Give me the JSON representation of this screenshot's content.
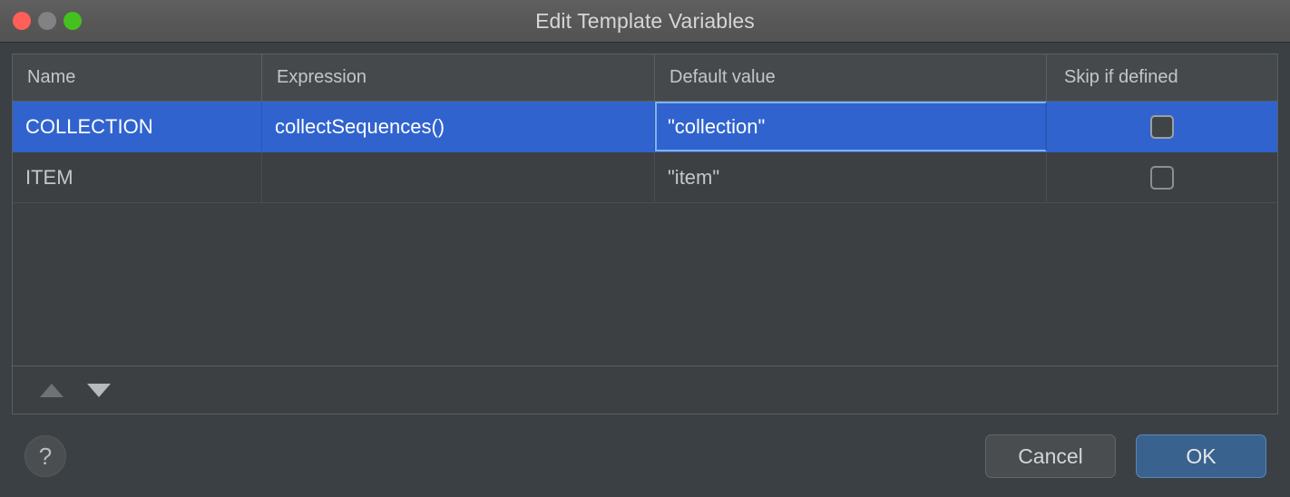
{
  "window": {
    "title": "Edit Template Variables",
    "traffic_lights": [
      {
        "name": "close",
        "color": "#ff5f57"
      },
      {
        "name": "minimize",
        "color": "#828282"
      },
      {
        "name": "zoom",
        "color": "#44c01f"
      }
    ]
  },
  "table": {
    "columns": [
      {
        "key": "name",
        "label": "Name"
      },
      {
        "key": "expression",
        "label": "Expression"
      },
      {
        "key": "default_value",
        "label": "Default value"
      },
      {
        "key": "skip_if_defined",
        "label": "Skip if defined"
      }
    ],
    "rows": [
      {
        "name": "COLLECTION",
        "expression": "collectSequences()",
        "default_value": "\"collection\"",
        "skip_if_defined": false,
        "selected": true,
        "focused_cell": "default_value"
      },
      {
        "name": "ITEM",
        "expression": "",
        "default_value": "\"item\"",
        "skip_if_defined": false,
        "selected": false,
        "focused_cell": ""
      }
    ]
  },
  "toolbar": {
    "move_up_label": "Move up",
    "move_up_icon": "triangle-up-icon",
    "move_up_enabled": false,
    "move_down_label": "Move down",
    "move_down_icon": "triangle-down-icon",
    "move_down_enabled": true
  },
  "footer": {
    "help_label": "?",
    "cancel_label": "Cancel",
    "ok_label": "OK"
  },
  "colors": {
    "selection_blue": "#3063ce",
    "focus_border": "#7fb3ef",
    "default_button_blue": "#3a628f",
    "window_background": "#3b4044",
    "table_background": "#3c4043",
    "titlebar": "#575757"
  }
}
